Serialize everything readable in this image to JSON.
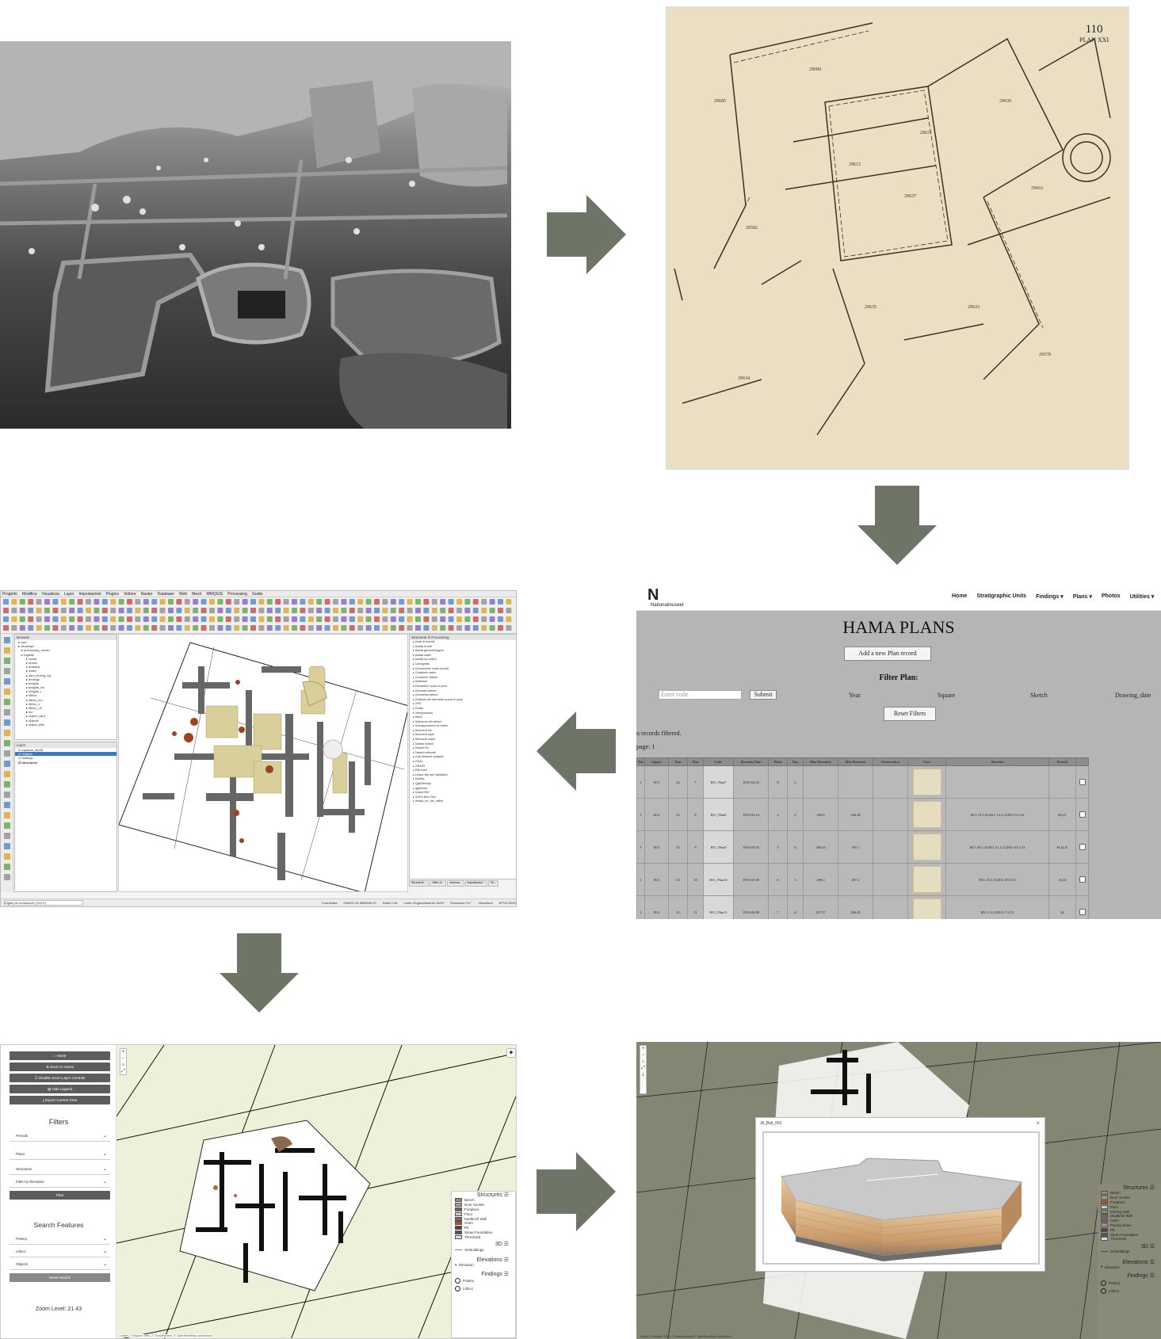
{
  "web_app": {
    "logo": "N",
    "logo_subtitle": "Nationalmuseet",
    "nav": [
      "Home",
      "Stratigraphic Units",
      "Findings ▾",
      "Plans ▾",
      "Photos",
      "Utilities ▾",
      "U"
    ],
    "title": "HAMA PLANS",
    "add_button": "Add a new Plan record",
    "filter_title": "Filter Plan:",
    "code_placeholder": "Enter code",
    "submit": "Submit",
    "filter_labels": [
      "Year",
      "Square",
      "Sketch",
      "Drawing_date"
    ],
    "reset": "Reset Filters",
    "records_text": "n records filtered.",
    "page_text": "page: 1",
    "table": {
      "headers": [
        "Site",
        "Square",
        "Year",
        "Plan",
        "Code",
        "Drawing Date",
        "Week",
        "Day",
        "Max Elevation",
        "Min Elevation",
        "Preservation",
        "View",
        "Sketches",
        "Periods"
      ],
      "rows": [
        [
          "1",
          "H11",
          "32",
          "7",
          "H11_Plan7",
          "1932-04-25",
          "8",
          "2",
          "",
          "",
          "",
          "",
          "",
          ""
        ],
        [
          "1",
          "H11",
          "33",
          "8",
          "H11_Plan8",
          "1933-03-14",
          "4",
          "2",
          "299.6",
          "296.48",
          "",
          "",
          "H11-13.3.33,H11-14.3.33,H11-9.3.33",
          "H3,J1"
        ],
        [
          "1",
          "H11",
          "33",
          "9",
          "H11_Plan9",
          "1933-03-25",
          "5",
          "6",
          "296.63",
          "297.1",
          "",
          "",
          "H11-20.3.33,H11-21.3.33,H11-23.3.33",
          "H,J2,J3"
        ],
        [
          "1",
          "H11",
          "33",
          "10",
          "H11_Plan10",
          "1933-03-29",
          "6",
          "3",
          "298.2",
          "297.2",
          "",
          "",
          "H11-25.3.33,H11-29.3.33",
          "J3,J4"
        ],
        [
          "1",
          "H11",
          "33",
          "11",
          "H11_Plan11",
          "1933-04-08",
          "7",
          "4",
          "297.57",
          "296.45",
          "",
          "",
          "H11-1.4.33,H11-7.4.33",
          "J4"
        ]
      ]
    }
  },
  "plan_drawing": {
    "number": "110",
    "subtitle": "PLAN XXI"
  },
  "qgis": {
    "menu": [
      "Progetto",
      "Modifica",
      "Visualizza",
      "Layer",
      "Impostazioni",
      "Plugins",
      "Vettore",
      "Raster",
      "Database",
      "Web",
      "Mesh",
      "MMQGIS",
      "Processing",
      "Guida"
    ],
    "browser_title": "Browser",
    "browser_items": [
      "user",
      "ceramiqa",
      "processing_model",
      "Inglese",
      "hama",
      "boxes",
      "ambient",
      "dates",
      "altro_boring_bg",
      "findings",
      "heights",
      "heights_inv",
      "heights_r",
      "lithics",
      "lithics_inv",
      "lithics_c",
      "lithics_u2",
      "lox",
      "object_card",
      "objects",
      "object_files"
    ],
    "layers_title": "Layer",
    "layers": [
      "squares_Mp28",
      "heights",
      "findings",
      "structures"
    ],
    "toolbox_title": "Strumenti di Processing",
    "toolbox_items": [
      "Usati di recente",
      "Analisi di rete",
      "Analisi geomorfologica",
      "Analisi raster",
      "Analisi sui vettori",
      "Cartografia",
      "Conversione vuoto di punti",
      "Creazione raster",
      "Creazione vettore",
      "Database",
      "Elevazione vuoto di punti",
      "Generale vettore",
      "Geometria vettore",
      "Gestione dei dati della nuvola di punti",
      "GPS",
      "Grafici",
      "Interpolazione",
      "Mesh",
      "Selezione del vettore",
      "Sovrapposizione di vettori",
      "Strumenti file",
      "Strumenti layer",
      "Strumenti raster",
      "Tabella vettore",
      "Tasselli 3D",
      "Tasselli vettoriali",
      "Cost distance analysis",
      "GDAL",
      "GRASS",
      "EMI tools",
      "Lessor site and Validation",
      "Models",
      "Qgis2threejs",
      "qgis2web",
      "QuickOSM",
      "SAGA Next Gen",
      "thanks_for_the_coffee"
    ],
    "bottom_tabs": [
      "Strumenti ...",
      "Stile La...",
      "Informa...",
      "Impostazion...",
      "Ve..."
    ],
    "locator": "Digita per localizzare (Ctrl+K)",
    "status": [
      "Coordinata",
      "294870,15  3893606,29",
      "Scala 1:96",
      "Lente d'ingrandimento 100%",
      "Rotazione 0,0 °",
      "Visualizza",
      "EPSG:32637"
    ]
  },
  "leaflet": {
    "buttons": [
      "⌂ Home",
      "⊕ Zoom to Hama",
      "☰ Disable Zoom Layer Controls",
      "▤ Hide Legend",
      "⤓ Export Current View"
    ],
    "filters_title": "Filters",
    "filters": [
      "Periods",
      "Plans",
      "Structures",
      "Filter by Elevation"
    ],
    "filter_button": "Filter",
    "search_title": "Search Features",
    "search": [
      "Pottery",
      "Lithics",
      "Objects"
    ],
    "reset_search": "Reset Search",
    "zoom_level": "Zoom Level: 21.43",
    "legend_title": "Structures ☰",
    "legend_items": [
      "Bench",
      "Door Socket",
      "Fireplace",
      "Floor",
      "Mudbrick Wall",
      "Oven",
      "Pit",
      "Stone Foundation",
      "Threshold"
    ],
    "legend_3d": "3D ☰",
    "legend_3d_item": "3d Buildings",
    "legend_elev": "Elevations ☰",
    "legend_elev_item": "Elevation",
    "legend_find": "Findings ☰",
    "legend_find_items": [
      "Pottery",
      "Lithics"
    ],
    "attribution": "Leaflet | © Mapbox Tiles | © Thunderforest | © OpenStreetMap contributors",
    "colors": {
      "legend": [
        "#9b8a5a",
        "#a0a0a0",
        "#9a5a3a",
        "#c8c8c8",
        "#7a6a4a",
        "#b44a2a",
        "#444444",
        "#555555",
        "#dddddd"
      ]
    }
  },
  "view3d": {
    "modal_title": "J6_Buil_001",
    "close": "×",
    "legend_title": "Structures ☰",
    "legend_items": [
      "Bench",
      "Door Socket",
      "Fireplace",
      "Floor",
      "Moving Wall",
      "Mudbrick Wall",
      "Oven",
      "Paving stone",
      "Pit",
      "Stone Foundation",
      "Threshold"
    ],
    "legend_3d": "3D ☰",
    "legend_3d_item": "3d Buildings",
    "legend_elev": "Elevations ☰",
    "legend_elev_item": "Elevation",
    "legend_find": "Findings ☰",
    "legend_find_items": [
      "Pottery",
      "Lithics"
    ],
    "attribution": "Leaflet | © Mapbox Tiles | © Thunderforest | © OpenStreetMap contributors",
    "colors": {
      "legend": [
        "#9b8a5a",
        "#a0a0a0",
        "#9a5a3a",
        "#c8c8c8",
        "#888888",
        "#7a6a4a",
        "#b44a2a",
        "#999999",
        "#444444",
        "#555555",
        "#dddddd"
      ]
    }
  },
  "arrow_color": "#6e7466"
}
